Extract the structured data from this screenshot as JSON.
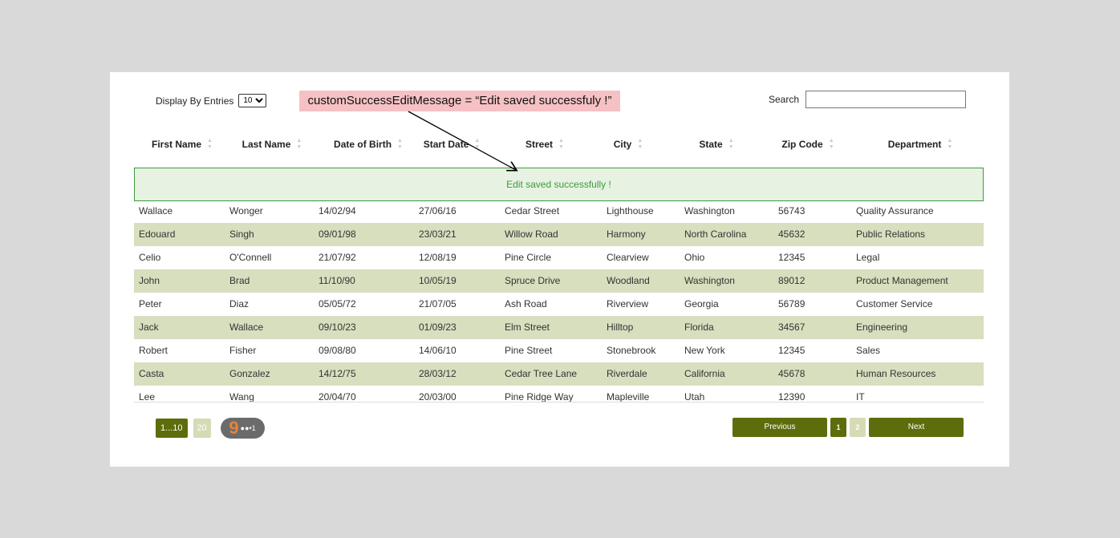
{
  "controls": {
    "entries_label": "Display By Entries",
    "entries_value": "10",
    "search_label": "Search",
    "search_value": ""
  },
  "annotation": {
    "text": "customSuccessEditMessage = “Edit saved successfuly !”"
  },
  "columns": [
    "First Name",
    "Last Name",
    "Date of Birth",
    "Start Date",
    "Street",
    "City",
    "State",
    "Zip Code",
    "Department"
  ],
  "success_message": "Edit saved successfully !",
  "rows": [
    [
      "Wallace",
      "Wonger",
      "14/02/94",
      "27/06/16",
      "Cedar Street",
      "Lighthouse",
      "Washington",
      "56743",
      "Quality Assurance"
    ],
    [
      "Edouard",
      "Singh",
      "09/01/98",
      "23/03/21",
      "Willow Road",
      "Harmony",
      "North Carolina",
      "45632",
      "Public Relations"
    ],
    [
      "Celio",
      "O'Connell",
      "21/07/92",
      "12/08/19",
      "Pine Circle",
      "Clearview",
      "Ohio",
      "12345",
      "Legal"
    ],
    [
      "John",
      "Brad",
      "11/10/90",
      "10/05/19",
      "Spruce Drive",
      "Woodland",
      "Washington",
      "89012",
      "Product Management"
    ],
    [
      "Peter",
      "Diaz",
      "05/05/72",
      "21/07/05",
      "Ash Road",
      "Riverview",
      "Georgia",
      "56789",
      "Customer Service"
    ],
    [
      "Jack",
      "Wallace",
      "09/10/23",
      "01/09/23",
      "Elm Street",
      "Hilltop",
      "Florida",
      "34567",
      "Engineering"
    ],
    [
      "Robert",
      "Fisher",
      "09/08/80",
      "14/06/10",
      "Pine Street",
      "Stonebrook",
      "New York",
      "12345",
      "Sales"
    ],
    [
      "Casta",
      "Gonzalez",
      "14/12/75",
      "28/03/12",
      "Cedar Tree Lane",
      "Riverdale",
      "California",
      "45678",
      "Human Resources"
    ],
    [
      "Lee",
      "Wang",
      "20/04/70",
      "20/03/00",
      "Pine Ridge Way",
      "Mapleville",
      "Utah",
      "12390",
      "IT"
    ]
  ],
  "pager_left": {
    "range_label": "1...10",
    "count_label": "20",
    "badge_digit": "9",
    "badge_dots": "●●•1"
  },
  "pager_right": {
    "previous_label": "Previous",
    "pages": [
      "1",
      "2"
    ],
    "next_label": "Next"
  },
  "colors": {
    "accent": "#5d6d0c",
    "row_alt": "#d7dfbf",
    "success_bg": "#e7f2e3",
    "success_text": "#3d9a3b",
    "annotation_bg": "#f6c1c4"
  },
  "icons": {
    "sort": "sort-arrows-icon",
    "badge": "gear-badge-icon"
  }
}
